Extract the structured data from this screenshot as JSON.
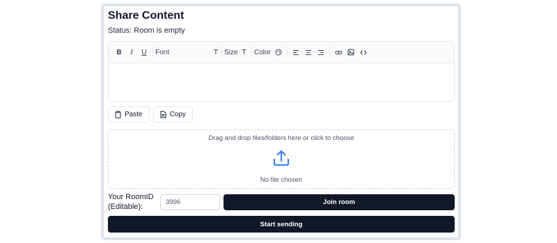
{
  "title": "Share Content",
  "status": "Status: Room is empty",
  "toolbar": {
    "bold": "B",
    "italic": "I",
    "underline": "U",
    "font_label": "Font",
    "size_label": "Size",
    "color_label": "Color",
    "picker_icon": "T"
  },
  "buttons": {
    "paste": "Paste",
    "copy": "Copy",
    "join": "Join room",
    "start": "Start sending"
  },
  "dropzone": {
    "instruction": "Drag and drop files/folders here or click to choose",
    "file_status": "No file chosen"
  },
  "room": {
    "label_line1": "Your RoomID",
    "label_line2": "(Editable):",
    "value": "3996"
  },
  "colors": {
    "primary": "#111827",
    "upload_icon": "#3b82f6",
    "card_border": "#dde3ea"
  },
  "icons": [
    "bold-icon",
    "italic-icon",
    "underline-icon",
    "font-icon",
    "size-icon",
    "color-palette-icon",
    "align-left-icon",
    "align-center-icon",
    "align-right-icon",
    "link-icon",
    "image-icon",
    "code-icon",
    "clipboard-icon",
    "copy-icon",
    "upload-icon"
  ]
}
